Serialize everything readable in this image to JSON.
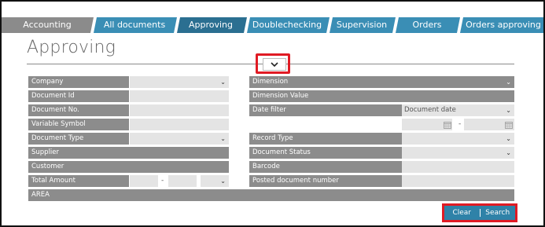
{
  "tabs": [
    {
      "label": "Accounting"
    },
    {
      "label": "All documents"
    },
    {
      "label": "Approving"
    },
    {
      "label": "Doublechecking"
    },
    {
      "label": "Supervision"
    },
    {
      "label": "Orders"
    },
    {
      "label": "Orders approving"
    }
  ],
  "page": {
    "title": "Approving"
  },
  "form": {
    "left": {
      "company": "Company",
      "document_id": "Document Id",
      "document_no": "Document No.",
      "variable_symbol": "Variable Symbol",
      "document_type": "Document Type",
      "supplier": "Supplier",
      "customer": "Customer",
      "total_amount": "Total Amount",
      "range_sep": "-"
    },
    "right": {
      "dimension": "Dimension",
      "dimension_value": "Dimension Value",
      "date_filter": "Date filter",
      "date_filter_value": "Document date",
      "date_sep": "-",
      "record_type": "Record Type",
      "document_status": "Document Status",
      "barcode": "Barcode",
      "posted_document_number": "Posted document number"
    },
    "area": "AREA"
  },
  "buttons": {
    "clear": "Clear",
    "search": "Search"
  },
  "colors": {
    "tab_gray": "#8b8b8b",
    "tab_teal": "#3a8eb5",
    "tab_active": "#2b6f91",
    "label_gray": "#8c8c8c",
    "field_bg": "#e4e4e4",
    "highlight": "#e01b24",
    "button_blue": "#2f82a8"
  },
  "icons": {
    "expand": "chevron-down-icon",
    "calendar": "calendar-icon",
    "dropdown": "chevron-down-icon"
  }
}
